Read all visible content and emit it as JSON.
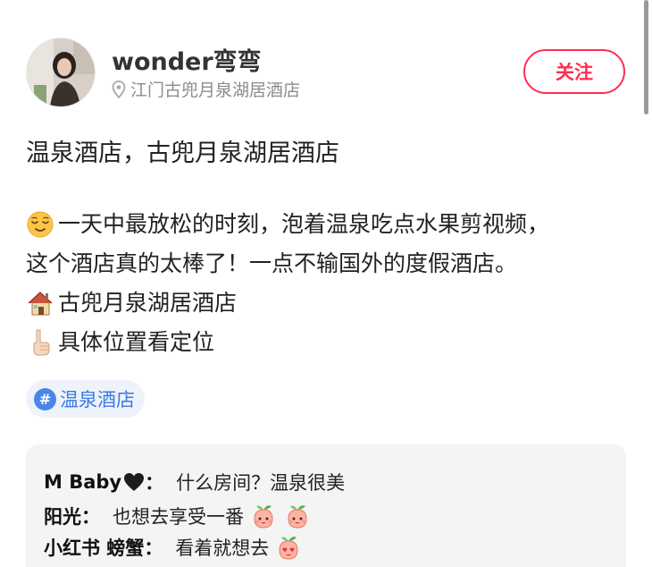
{
  "author": {
    "name": "wonder弯弯",
    "location": "江门古兜月泉湖居酒店",
    "avatar_icon": "avatar-photo"
  },
  "follow_label": "关注",
  "post": {
    "title": "温泉酒店，古兜月泉湖居酒店",
    "lines": [
      {
        "icon": "relieved-face-emoji",
        "text": "一天中最放松的时刻，泡着温泉吃点水果剪视频，"
      },
      {
        "icon": "",
        "text": "这个酒店真的太棒了！一点不输国外的度假酒店。"
      },
      {
        "icon": "house-emoji",
        "text": "古兜月泉湖居酒店"
      },
      {
        "icon": "pointing-down-emoji",
        "text": "具体位置看定位"
      }
    ]
  },
  "hashtag": {
    "symbol": "#",
    "label": "温泉酒店"
  },
  "comments": [
    {
      "author": "M Baby",
      "author_icon": "black-heart-emoji",
      "sep": "：",
      "text": "什么房间？温泉很美",
      "stickers": []
    },
    {
      "author": "阳光",
      "author_icon": "",
      "sep": "：",
      "text": "也想去享受一番",
      "stickers": [
        "peach-sticker-icon",
        "peach-sticker-icon"
      ]
    },
    {
      "author": "小红书 螃蟹",
      "author_icon": "",
      "sep": "：",
      "text": "看着就想去",
      "stickers": [
        "peach-heart-eyes-sticker-icon"
      ]
    }
  ],
  "colors": {
    "accent": "#ff2e4d",
    "hashtag": "#3d7ae0",
    "muted": "#8c8c8c"
  }
}
